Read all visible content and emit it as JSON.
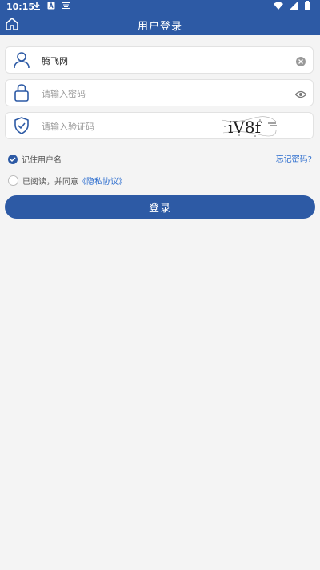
{
  "status_bar": {
    "time": "10:15"
  },
  "header": {
    "title": "用户登录"
  },
  "form": {
    "username": {
      "value": "腾飞网"
    },
    "password": {
      "placeholder": "请输入密码"
    },
    "captcha": {
      "placeholder": "请输入验证码",
      "code": "iV8f"
    }
  },
  "options": {
    "remember_label": "记住用户名",
    "forgot_label": "忘记密码?",
    "agree_prefix": "已阅读，并同意",
    "privacy_link": "《隐私协议》"
  },
  "login_button": "登录",
  "colors": {
    "primary": "#2d5aa5",
    "link": "#2f6fcf",
    "background": "#f4f4f4"
  }
}
